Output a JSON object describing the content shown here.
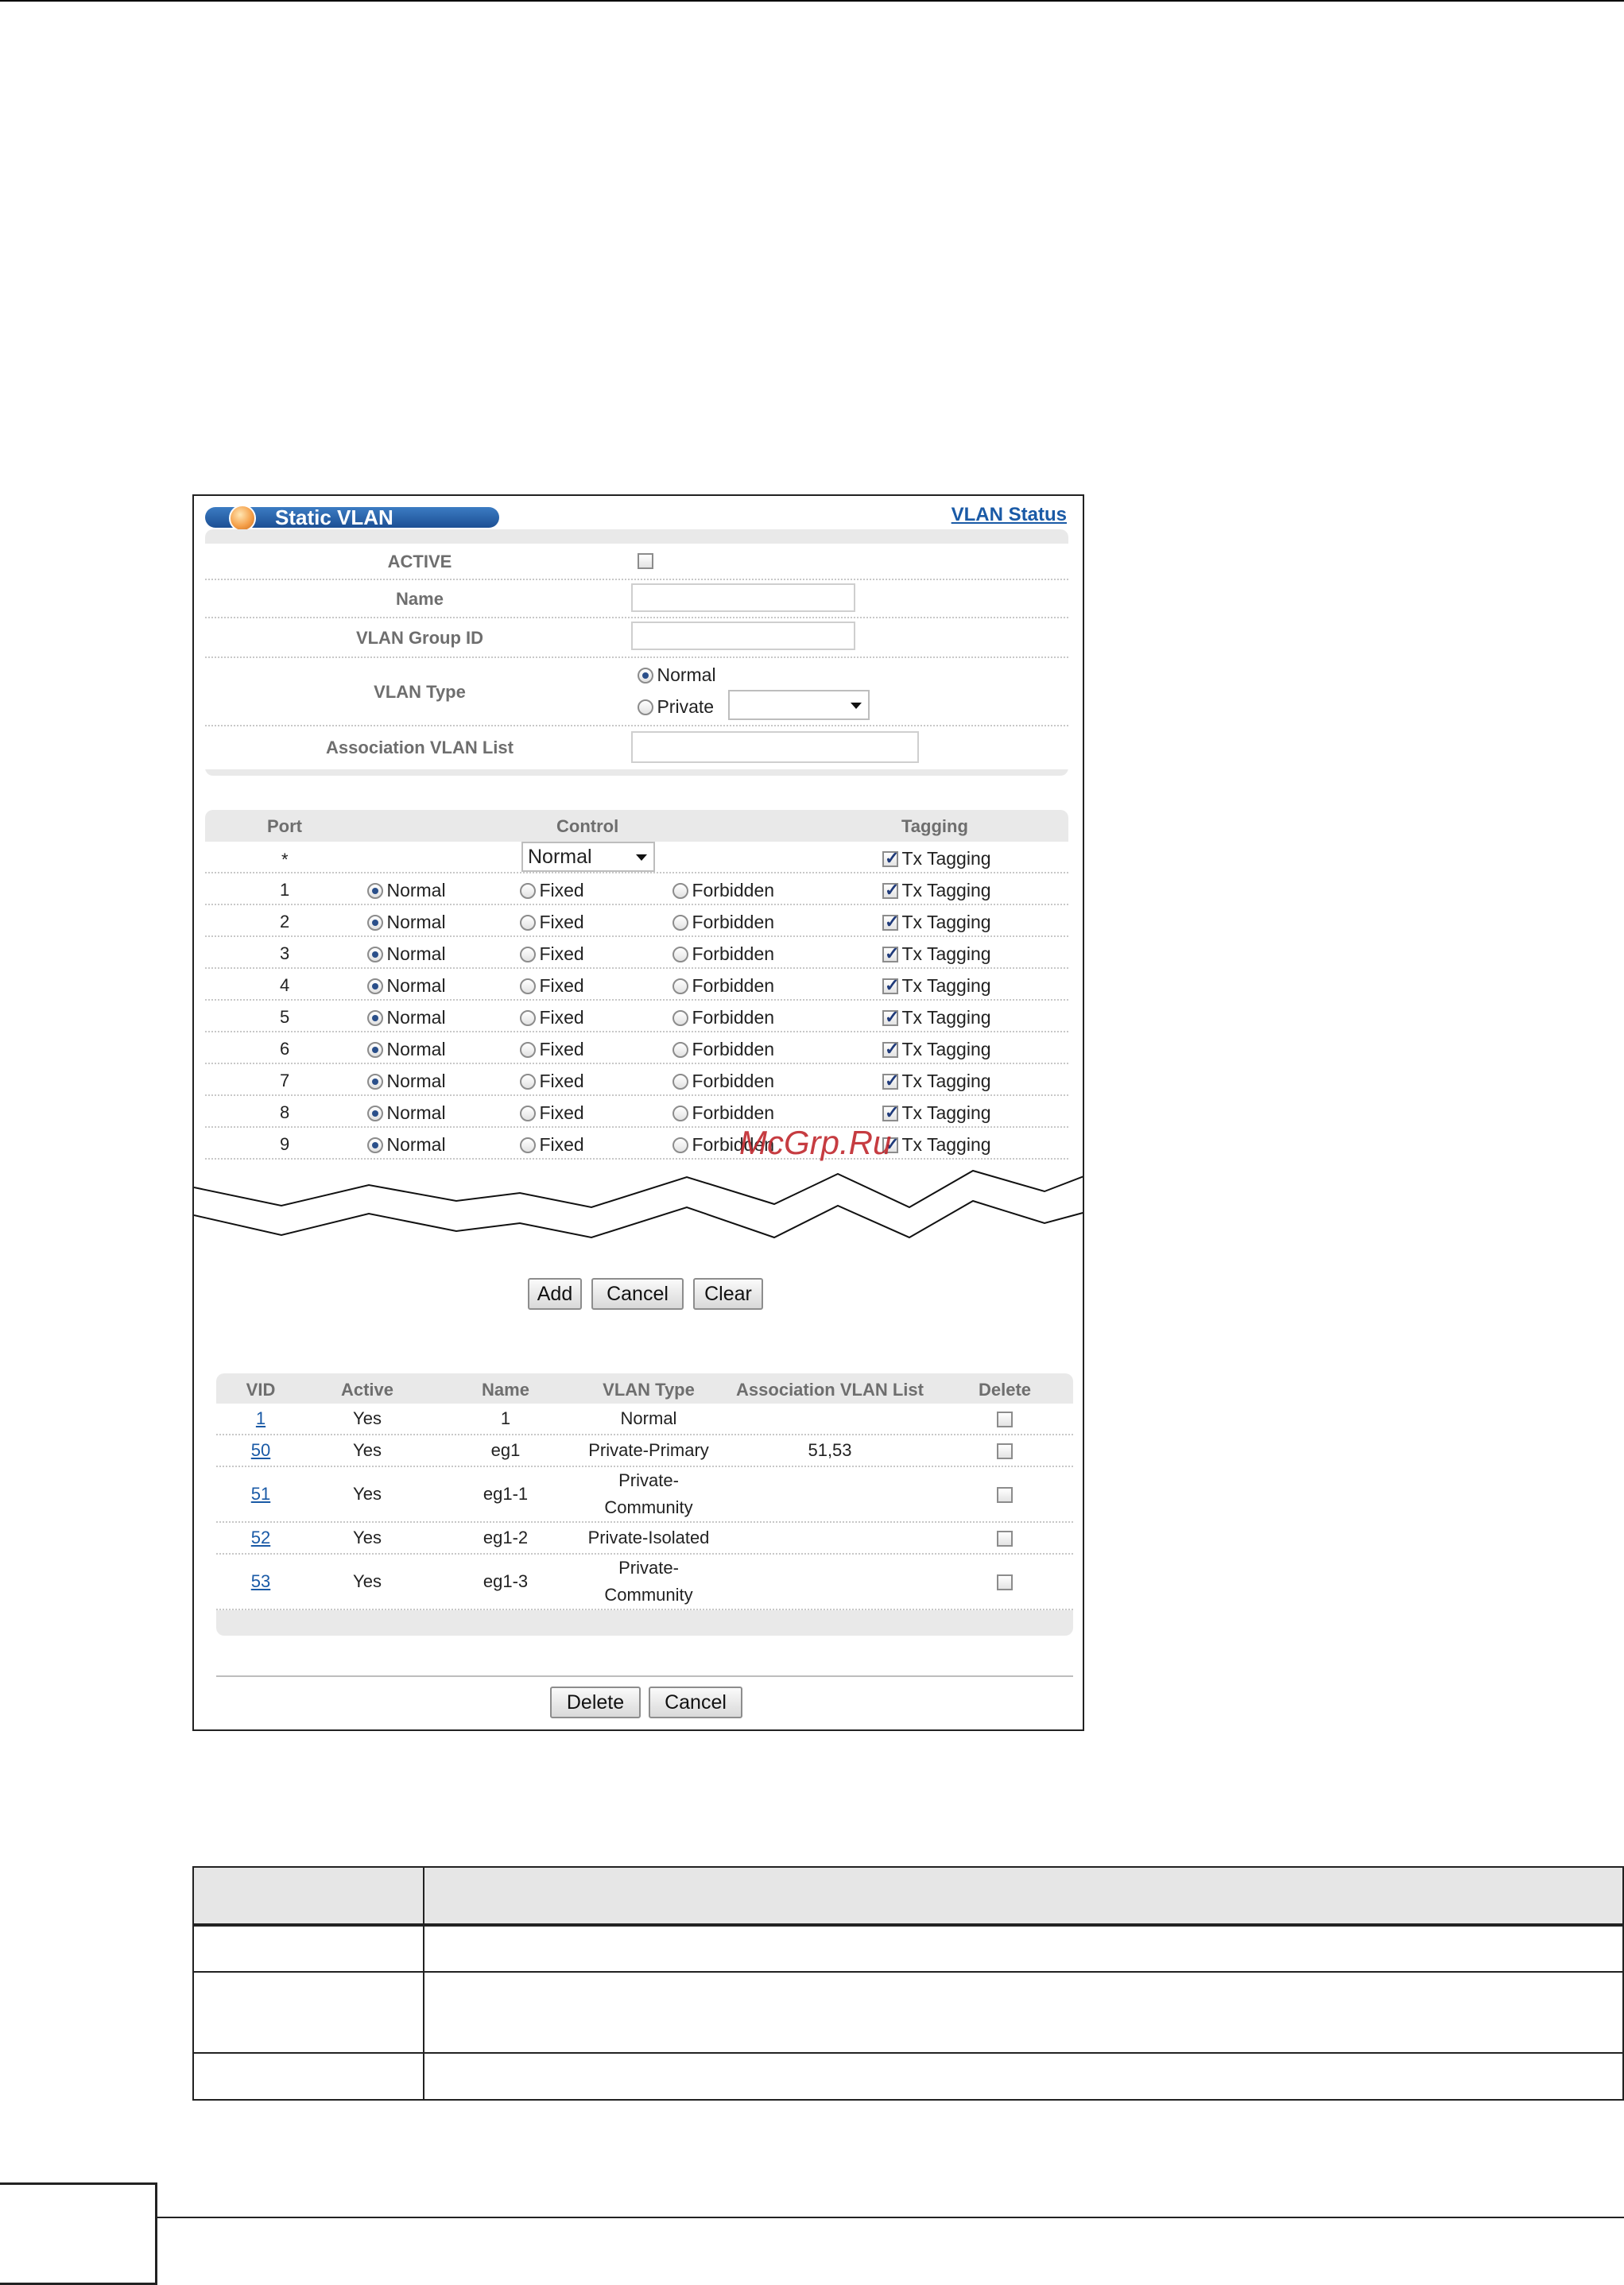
{
  "header": {
    "title": "Static VLAN",
    "status_link": "VLAN Status"
  },
  "form": {
    "active_label": "ACTIVE",
    "name_label": "Name",
    "group_id_label": "VLAN Group ID",
    "vlan_type_label": "VLAN Type",
    "type_normal": "Normal",
    "type_private": "Private",
    "assoc_label": "Association VLAN List"
  },
  "ports": {
    "headers": {
      "port": "Port",
      "control": "Control",
      "tagging": "Tagging"
    },
    "all_row": {
      "port": "*",
      "control_select": "Normal",
      "tagging": "Tx Tagging"
    },
    "labels": {
      "normal": "Normal",
      "fixed": "Fixed",
      "forbidden": "Forbidden",
      "tx": "Tx Tagging"
    },
    "rows": [
      "1",
      "2",
      "3",
      "4",
      "5",
      "6",
      "7",
      "8",
      "9"
    ]
  },
  "buttons": {
    "add": "Add",
    "cancel": "Cancel",
    "clear": "Clear",
    "delete": "Delete",
    "cancel2": "Cancel"
  },
  "vlan_list": {
    "headers": {
      "vid": "VID",
      "active": "Active",
      "name": "Name",
      "type": "VLAN Type",
      "assoc": "Association VLAN List",
      "delete": "Delete"
    },
    "rows": [
      {
        "vid": "1",
        "active": "Yes",
        "name": "1",
        "type_line1": "Normal",
        "type_line2": "",
        "assoc": ""
      },
      {
        "vid": "50",
        "active": "Yes",
        "name": "eg1",
        "type_line1": "Private-Primary",
        "type_line2": "",
        "assoc": "51,53"
      },
      {
        "vid": "51",
        "active": "Yes",
        "name": "eg1-1",
        "type_line1": "Private-",
        "type_line2": "Community",
        "assoc": ""
      },
      {
        "vid": "52",
        "active": "Yes",
        "name": "eg1-2",
        "type_line1": "Private-Isolated",
        "type_line2": "",
        "assoc": ""
      },
      {
        "vid": "53",
        "active": "Yes",
        "name": "eg1-3",
        "type_line1": "Private-",
        "type_line2": "Community",
        "assoc": ""
      }
    ]
  },
  "watermark": "McGrp.Ru"
}
